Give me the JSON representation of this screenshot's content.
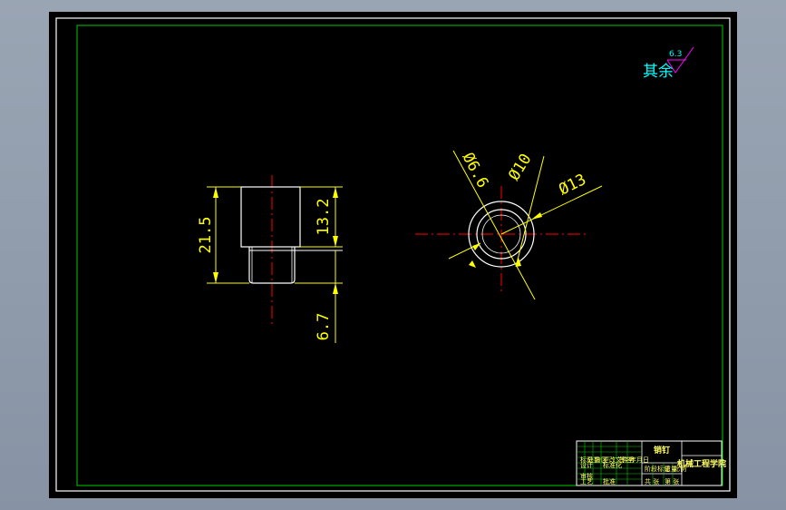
{
  "colors": {
    "background": "#000000",
    "frame_outer": "#ffffff",
    "frame_inner": "#00cc00",
    "centerline": "#ff0000",
    "dimension": "#ffff00",
    "outline": "#ffffff",
    "roughness": "#00ffff",
    "roughness_line": "#ff00ff"
  },
  "roughness_note": {
    "prefix": "其余",
    "value": "6.3"
  },
  "front_view": {
    "dim_total": "21.5",
    "dim_upper": "13.2",
    "dim_lower": "6.7"
  },
  "top_view": {
    "dia_hole": "Ø6.6",
    "dia_inner": "Ø10",
    "dia_outer": "Ø13"
  },
  "title_block": {
    "part_name": "销钉",
    "school": "机械工程学院",
    "cells": [
      "标记",
      "处数",
      "分区",
      "更改文件号",
      "签名",
      "年月日",
      "设计",
      "标准化",
      "阶段标记",
      "重量",
      "比例",
      "审核",
      "工艺",
      "批准",
      "共 张",
      "第 张"
    ]
  }
}
